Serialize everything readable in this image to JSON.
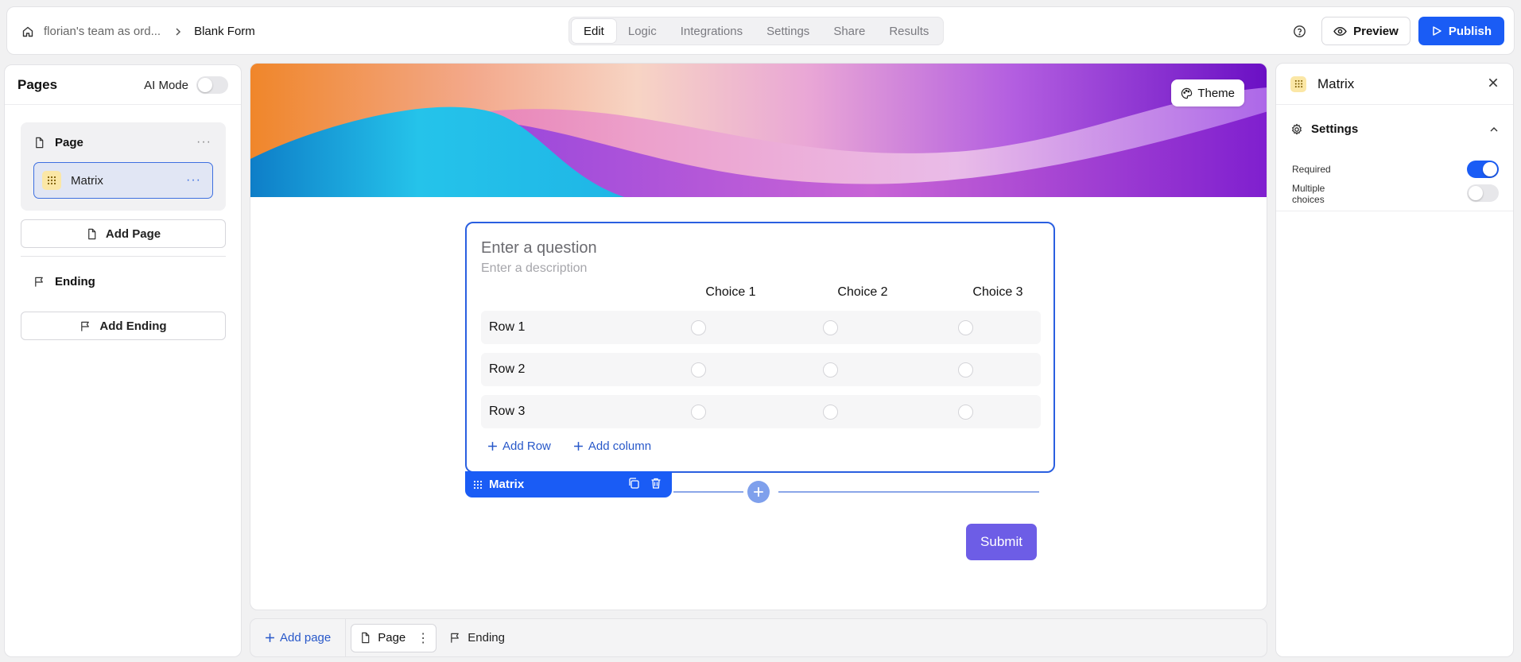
{
  "header": {
    "team_name": "florian's team as ord...",
    "form_name": "Blank Form",
    "tabs": [
      {
        "label": "Edit",
        "active": true
      },
      {
        "label": "Logic",
        "active": false
      },
      {
        "label": "Integrations",
        "active": false
      },
      {
        "label": "Settings",
        "active": false
      },
      {
        "label": "Share",
        "active": false
      },
      {
        "label": "Results",
        "active": false
      }
    ],
    "preview_label": "Preview",
    "publish_label": "Publish"
  },
  "left_sidebar": {
    "title": "Pages",
    "ai_mode_label": "AI Mode",
    "ai_mode_on": false,
    "page_label": "Page",
    "matrix_label": "Matrix",
    "add_page_label": "Add Page",
    "ending_label": "Ending",
    "add_ending_label": "Add Ending"
  },
  "canvas": {
    "theme_label": "Theme",
    "question_placeholder": "Enter a question",
    "description_placeholder": "Enter a description",
    "columns": [
      "Choice 1",
      "Choice 2",
      "Choice 3"
    ],
    "rows": [
      "Row 1",
      "Row 2",
      "Row 3"
    ],
    "add_row_label": "Add Row",
    "add_column_label": "Add column",
    "block_tag_label": "Matrix",
    "submit_label": "Submit"
  },
  "bottom_bar": {
    "add_page_label": "Add page",
    "page_label": "Page",
    "ending_label": "Ending"
  },
  "right_panel": {
    "title": "Matrix",
    "settings_label": "Settings",
    "required_label": "Required",
    "required_on": true,
    "multiple_choices_label_line1": "Multiple",
    "multiple_choices_label_line2": "choices",
    "multiple_choices_on": false
  },
  "colors": {
    "accent": "#1a5cf5",
    "submit": "#6d5de6",
    "selected_border": "#3d6fe0"
  }
}
